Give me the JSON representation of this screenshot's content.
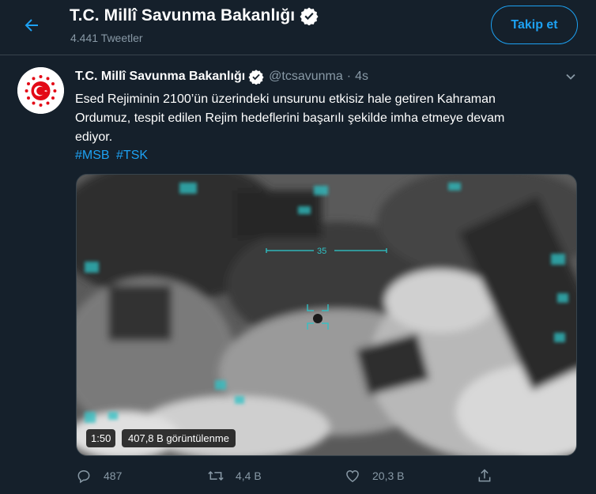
{
  "header": {
    "title": "T.C. Millî Savunma Bakanlığı",
    "subtitle": "4.441 Tweetler",
    "follow_label": "Takip et"
  },
  "tweet": {
    "name": "T.C. Millî Savunma Bakanlığı",
    "handle": "@tcsavunma",
    "separator": "·",
    "time": "4s",
    "text_line1": "Esed Rejiminin 2100’ün üzerindeki unsurunu etkisiz hale getiren Kahraman",
    "text_line2": "Ordumuz, tespit edilen Rejim hedeflerini başarılı şekilde imha etmeye devam",
    "text_line3": "ediyor.",
    "hashtags": [
      "#MSB",
      "#TSK"
    ],
    "media": {
      "duration": "1:50",
      "views": "407,8 B görüntülenme",
      "hud_number": "35"
    },
    "actions": {
      "replies": "487",
      "retweets": "4,4 B",
      "likes": "20,3 B"
    }
  },
  "colors": {
    "background": "#15202b",
    "accent": "#1da1f2",
    "secondary_text": "#8899a6",
    "border": "#38444d"
  },
  "icons": [
    "back-arrow-icon",
    "verified-badge-icon",
    "caret-down-icon",
    "reply-icon",
    "retweet-icon",
    "like-icon",
    "share-icon"
  ]
}
